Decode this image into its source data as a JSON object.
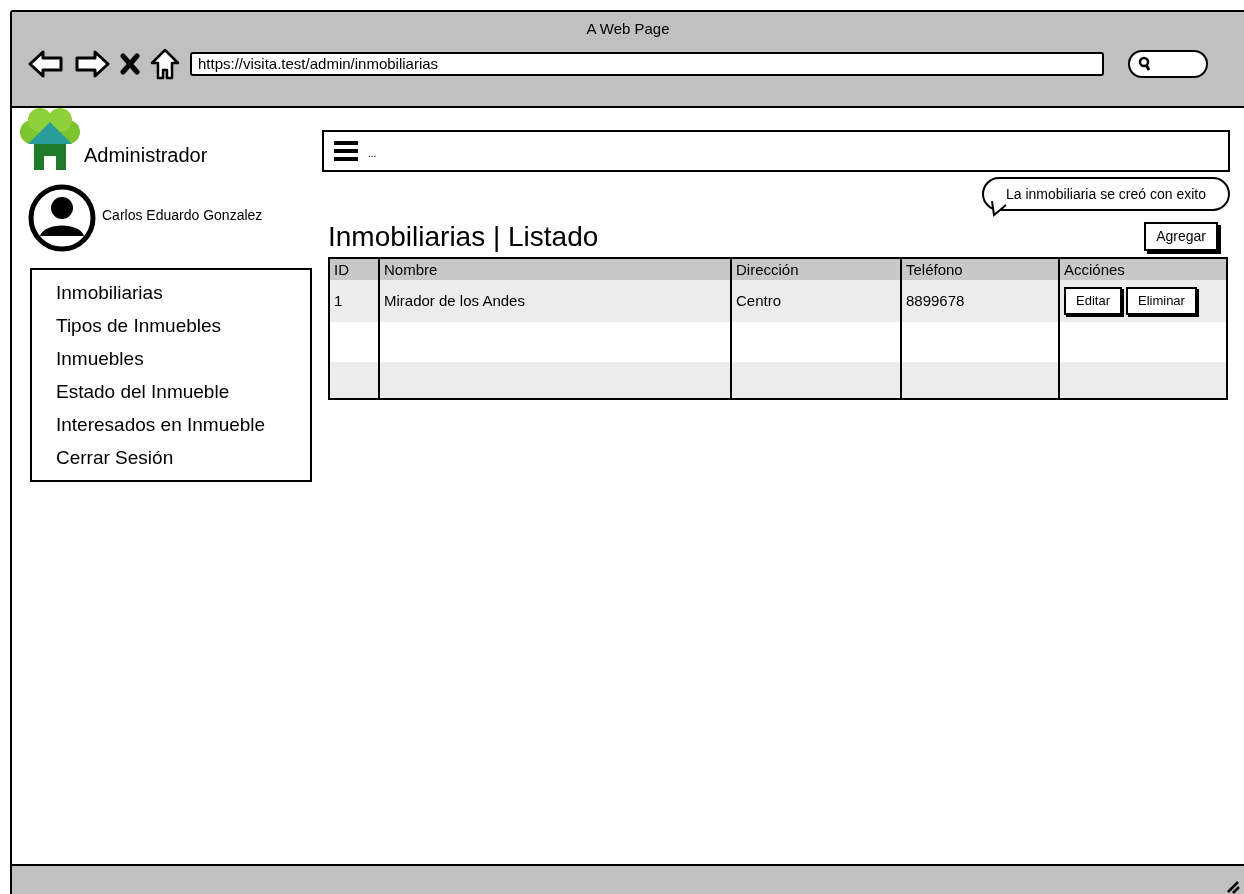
{
  "window": {
    "title": "A Web Page"
  },
  "browser": {
    "url": "https://visita.test/admin/inmobiliarias"
  },
  "sidebar": {
    "brand": "Administrador",
    "user_name": "Carlos Eduardo Gonzalez",
    "items": [
      {
        "label": "Inmobiliarias"
      },
      {
        "label": "Tipos de Inmuebles"
      },
      {
        "label": "Inmuebles"
      },
      {
        "label": "Estado del Inmueble"
      },
      {
        "label": "Interesados en Inmueble"
      },
      {
        "label": "Cerrar Sesión"
      }
    ]
  },
  "menubar": {
    "text": "..."
  },
  "notification": {
    "text": "La inmobiliaria se creó con exito"
  },
  "page_title": "Inmobiliarias | Listado",
  "add_button": "Agregar",
  "table": {
    "columns": [
      "ID",
      "Nombre",
      "Dirección",
      "Teléfono",
      "Acciónes"
    ],
    "rows": [
      {
        "cells": [
          "1",
          "Mirador de los Andes",
          "Centro",
          "8899678"
        ],
        "actions": [
          "Editar",
          "Eliminar"
        ]
      }
    ]
  }
}
